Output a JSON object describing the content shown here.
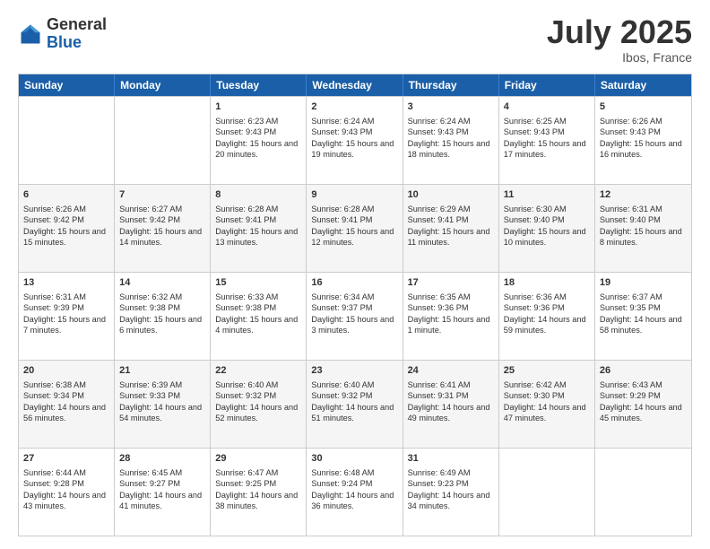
{
  "header": {
    "logo_general": "General",
    "logo_blue": "Blue",
    "month": "July 2025",
    "location": "Ibos, France"
  },
  "days_of_week": [
    "Sunday",
    "Monday",
    "Tuesday",
    "Wednesday",
    "Thursday",
    "Friday",
    "Saturday"
  ],
  "rows": [
    [
      {
        "day": "",
        "sunrise": "",
        "sunset": "",
        "daylight": ""
      },
      {
        "day": "",
        "sunrise": "",
        "sunset": "",
        "daylight": ""
      },
      {
        "day": "1",
        "sunrise": "Sunrise: 6:23 AM",
        "sunset": "Sunset: 9:43 PM",
        "daylight": "Daylight: 15 hours and 20 minutes."
      },
      {
        "day": "2",
        "sunrise": "Sunrise: 6:24 AM",
        "sunset": "Sunset: 9:43 PM",
        "daylight": "Daylight: 15 hours and 19 minutes."
      },
      {
        "day": "3",
        "sunrise": "Sunrise: 6:24 AM",
        "sunset": "Sunset: 9:43 PM",
        "daylight": "Daylight: 15 hours and 18 minutes."
      },
      {
        "day": "4",
        "sunrise": "Sunrise: 6:25 AM",
        "sunset": "Sunset: 9:43 PM",
        "daylight": "Daylight: 15 hours and 17 minutes."
      },
      {
        "day": "5",
        "sunrise": "Sunrise: 6:26 AM",
        "sunset": "Sunset: 9:43 PM",
        "daylight": "Daylight: 15 hours and 16 minutes."
      }
    ],
    [
      {
        "day": "6",
        "sunrise": "Sunrise: 6:26 AM",
        "sunset": "Sunset: 9:42 PM",
        "daylight": "Daylight: 15 hours and 15 minutes."
      },
      {
        "day": "7",
        "sunrise": "Sunrise: 6:27 AM",
        "sunset": "Sunset: 9:42 PM",
        "daylight": "Daylight: 15 hours and 14 minutes."
      },
      {
        "day": "8",
        "sunrise": "Sunrise: 6:28 AM",
        "sunset": "Sunset: 9:41 PM",
        "daylight": "Daylight: 15 hours and 13 minutes."
      },
      {
        "day": "9",
        "sunrise": "Sunrise: 6:28 AM",
        "sunset": "Sunset: 9:41 PM",
        "daylight": "Daylight: 15 hours and 12 minutes."
      },
      {
        "day": "10",
        "sunrise": "Sunrise: 6:29 AM",
        "sunset": "Sunset: 9:41 PM",
        "daylight": "Daylight: 15 hours and 11 minutes."
      },
      {
        "day": "11",
        "sunrise": "Sunrise: 6:30 AM",
        "sunset": "Sunset: 9:40 PM",
        "daylight": "Daylight: 15 hours and 10 minutes."
      },
      {
        "day": "12",
        "sunrise": "Sunrise: 6:31 AM",
        "sunset": "Sunset: 9:40 PM",
        "daylight": "Daylight: 15 hours and 8 minutes."
      }
    ],
    [
      {
        "day": "13",
        "sunrise": "Sunrise: 6:31 AM",
        "sunset": "Sunset: 9:39 PM",
        "daylight": "Daylight: 15 hours and 7 minutes."
      },
      {
        "day": "14",
        "sunrise": "Sunrise: 6:32 AM",
        "sunset": "Sunset: 9:38 PM",
        "daylight": "Daylight: 15 hours and 6 minutes."
      },
      {
        "day": "15",
        "sunrise": "Sunrise: 6:33 AM",
        "sunset": "Sunset: 9:38 PM",
        "daylight": "Daylight: 15 hours and 4 minutes."
      },
      {
        "day": "16",
        "sunrise": "Sunrise: 6:34 AM",
        "sunset": "Sunset: 9:37 PM",
        "daylight": "Daylight: 15 hours and 3 minutes."
      },
      {
        "day": "17",
        "sunrise": "Sunrise: 6:35 AM",
        "sunset": "Sunset: 9:36 PM",
        "daylight": "Daylight: 15 hours and 1 minute."
      },
      {
        "day": "18",
        "sunrise": "Sunrise: 6:36 AM",
        "sunset": "Sunset: 9:36 PM",
        "daylight": "Daylight: 14 hours and 59 minutes."
      },
      {
        "day": "19",
        "sunrise": "Sunrise: 6:37 AM",
        "sunset": "Sunset: 9:35 PM",
        "daylight": "Daylight: 14 hours and 58 minutes."
      }
    ],
    [
      {
        "day": "20",
        "sunrise": "Sunrise: 6:38 AM",
        "sunset": "Sunset: 9:34 PM",
        "daylight": "Daylight: 14 hours and 56 minutes."
      },
      {
        "day": "21",
        "sunrise": "Sunrise: 6:39 AM",
        "sunset": "Sunset: 9:33 PM",
        "daylight": "Daylight: 14 hours and 54 minutes."
      },
      {
        "day": "22",
        "sunrise": "Sunrise: 6:40 AM",
        "sunset": "Sunset: 9:32 PM",
        "daylight": "Daylight: 14 hours and 52 minutes."
      },
      {
        "day": "23",
        "sunrise": "Sunrise: 6:40 AM",
        "sunset": "Sunset: 9:32 PM",
        "daylight": "Daylight: 14 hours and 51 minutes."
      },
      {
        "day": "24",
        "sunrise": "Sunrise: 6:41 AM",
        "sunset": "Sunset: 9:31 PM",
        "daylight": "Daylight: 14 hours and 49 minutes."
      },
      {
        "day": "25",
        "sunrise": "Sunrise: 6:42 AM",
        "sunset": "Sunset: 9:30 PM",
        "daylight": "Daylight: 14 hours and 47 minutes."
      },
      {
        "day": "26",
        "sunrise": "Sunrise: 6:43 AM",
        "sunset": "Sunset: 9:29 PM",
        "daylight": "Daylight: 14 hours and 45 minutes."
      }
    ],
    [
      {
        "day": "27",
        "sunrise": "Sunrise: 6:44 AM",
        "sunset": "Sunset: 9:28 PM",
        "daylight": "Daylight: 14 hours and 43 minutes."
      },
      {
        "day": "28",
        "sunrise": "Sunrise: 6:45 AM",
        "sunset": "Sunset: 9:27 PM",
        "daylight": "Daylight: 14 hours and 41 minutes."
      },
      {
        "day": "29",
        "sunrise": "Sunrise: 6:47 AM",
        "sunset": "Sunset: 9:25 PM",
        "daylight": "Daylight: 14 hours and 38 minutes."
      },
      {
        "day": "30",
        "sunrise": "Sunrise: 6:48 AM",
        "sunset": "Sunset: 9:24 PM",
        "daylight": "Daylight: 14 hours and 36 minutes."
      },
      {
        "day": "31",
        "sunrise": "Sunrise: 6:49 AM",
        "sunset": "Sunset: 9:23 PM",
        "daylight": "Daylight: 14 hours and 34 minutes."
      },
      {
        "day": "",
        "sunrise": "",
        "sunset": "",
        "daylight": ""
      },
      {
        "day": "",
        "sunrise": "",
        "sunset": "",
        "daylight": ""
      }
    ]
  ]
}
